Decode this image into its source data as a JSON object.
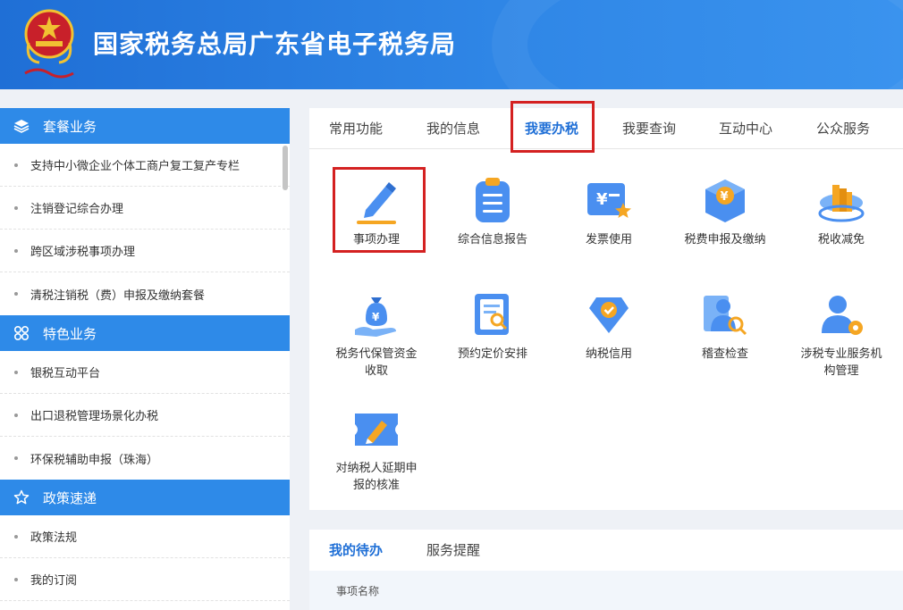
{
  "header": {
    "title": "国家税务总局广东省电子税务局"
  },
  "sidebar": {
    "sections": [
      {
        "title": "套餐业务",
        "icon": "layers-icon",
        "items": [
          "支持中小微企业个体工商户复工复产专栏",
          "注销登记综合办理",
          "跨区域涉税事项办理",
          "清税注销税（费）申报及缴纳套餐"
        ]
      },
      {
        "title": "特色业务",
        "icon": "grid-icon",
        "items": [
          "银税互动平台",
          "出口退税管理场景化办税",
          "环保税辅助申报（珠海）"
        ]
      },
      {
        "title": "政策速递",
        "icon": "star-icon",
        "items": [
          "政策法规",
          "我的订阅"
        ]
      }
    ]
  },
  "main": {
    "tabs": [
      "常用功能",
      "我的信息",
      "我要办税",
      "我要查询",
      "互动中心",
      "公众服务"
    ],
    "active_tab": "我要办税",
    "tiles": [
      {
        "label": "事项办理",
        "icon": "pencil-icon"
      },
      {
        "label": "综合信息报告",
        "icon": "clipboard-icon"
      },
      {
        "label": "发票使用",
        "icon": "invoice-icon"
      },
      {
        "label": "税费申报及缴纳",
        "icon": "tax-box-icon"
      },
      {
        "label": "税收减免",
        "icon": "coins-icon"
      },
      {
        "label": "税务代保管资金收取",
        "icon": "money-bag-icon"
      },
      {
        "label": "预约定价安排",
        "icon": "document-search-icon"
      },
      {
        "label": "纳税信用",
        "icon": "shield-check-icon"
      },
      {
        "label": "稽查检查",
        "icon": "inspector-icon"
      },
      {
        "label": "涉税专业服务机构管理",
        "icon": "agent-gear-icon"
      },
      {
        "label": "对纳税人延期申报的核准",
        "icon": "ticket-pencil-icon"
      }
    ]
  },
  "todo": {
    "tabs": [
      "我的待办",
      "服务提醒"
    ],
    "column_header": "事项名称"
  },
  "colors": {
    "brand_blue": "#2e8ae8",
    "highlight_red": "#d42121",
    "active_tab": "#1f6fd6"
  }
}
